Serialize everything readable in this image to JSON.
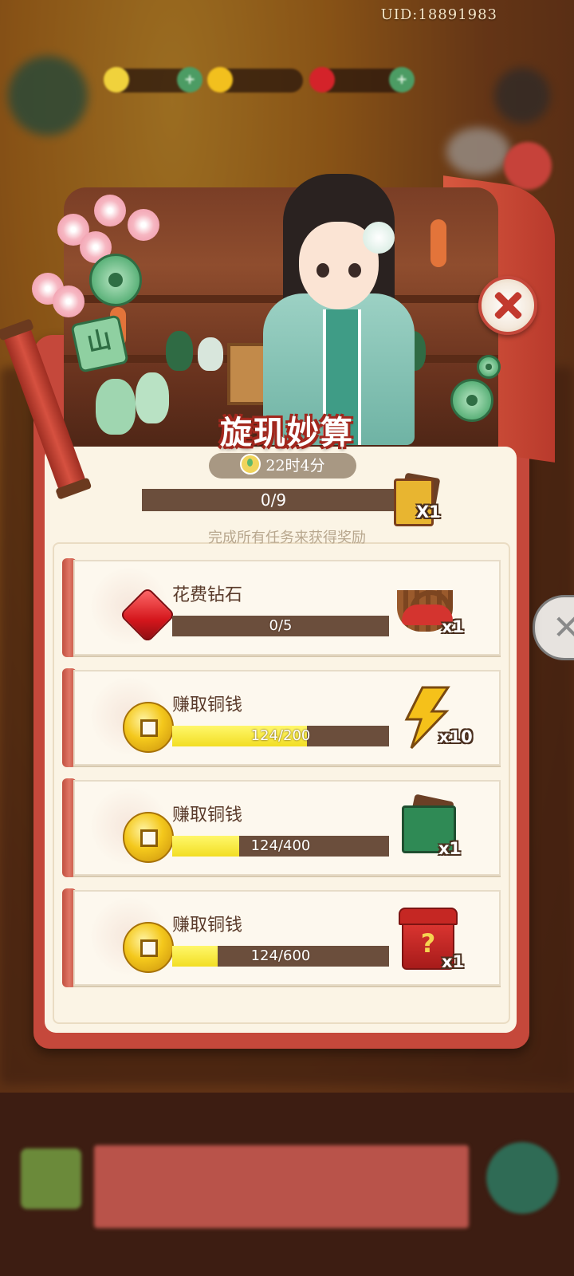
{
  "top": {
    "uid": "UID:18891983"
  },
  "event": {
    "title": "旋玑妙算",
    "timer": "22时4分",
    "overall_progress": "0/9",
    "overall_fraction": 0,
    "overall_reward_qty": "X1",
    "subtitle": "完成所有任务来获得奖励",
    "jade_tile_char": "山"
  },
  "tasks": [
    {
      "name": "花费钻石",
      "progress": "0/5",
      "fraction": 0,
      "reward_qty": "x1",
      "task_icon": "red-gem-icon",
      "reward_icon": "picnic-basket-icon"
    },
    {
      "name": "赚取铜钱",
      "progress": "124/200",
      "fraction": 0.62,
      "reward_qty": "x10",
      "task_icon": "copper-coin-icon",
      "reward_icon": "lightning-energy-icon"
    },
    {
      "name": "赚取铜钱",
      "progress": "124/400",
      "fraction": 0.31,
      "reward_qty": "x1",
      "task_icon": "copper-coin-icon",
      "reward_icon": "card-pack-icon"
    },
    {
      "name": "赚取铜钱",
      "progress": "124/600",
      "fraction": 0.21,
      "reward_qty": "x1",
      "task_icon": "copper-coin-icon",
      "reward_icon": "mystery-chest-icon"
    }
  ],
  "colors": {
    "frame_red": "#c5483b",
    "paper": "#fbf4e5",
    "bar_bg": "#6b4e3c",
    "bar_fill": "#f2de24"
  }
}
